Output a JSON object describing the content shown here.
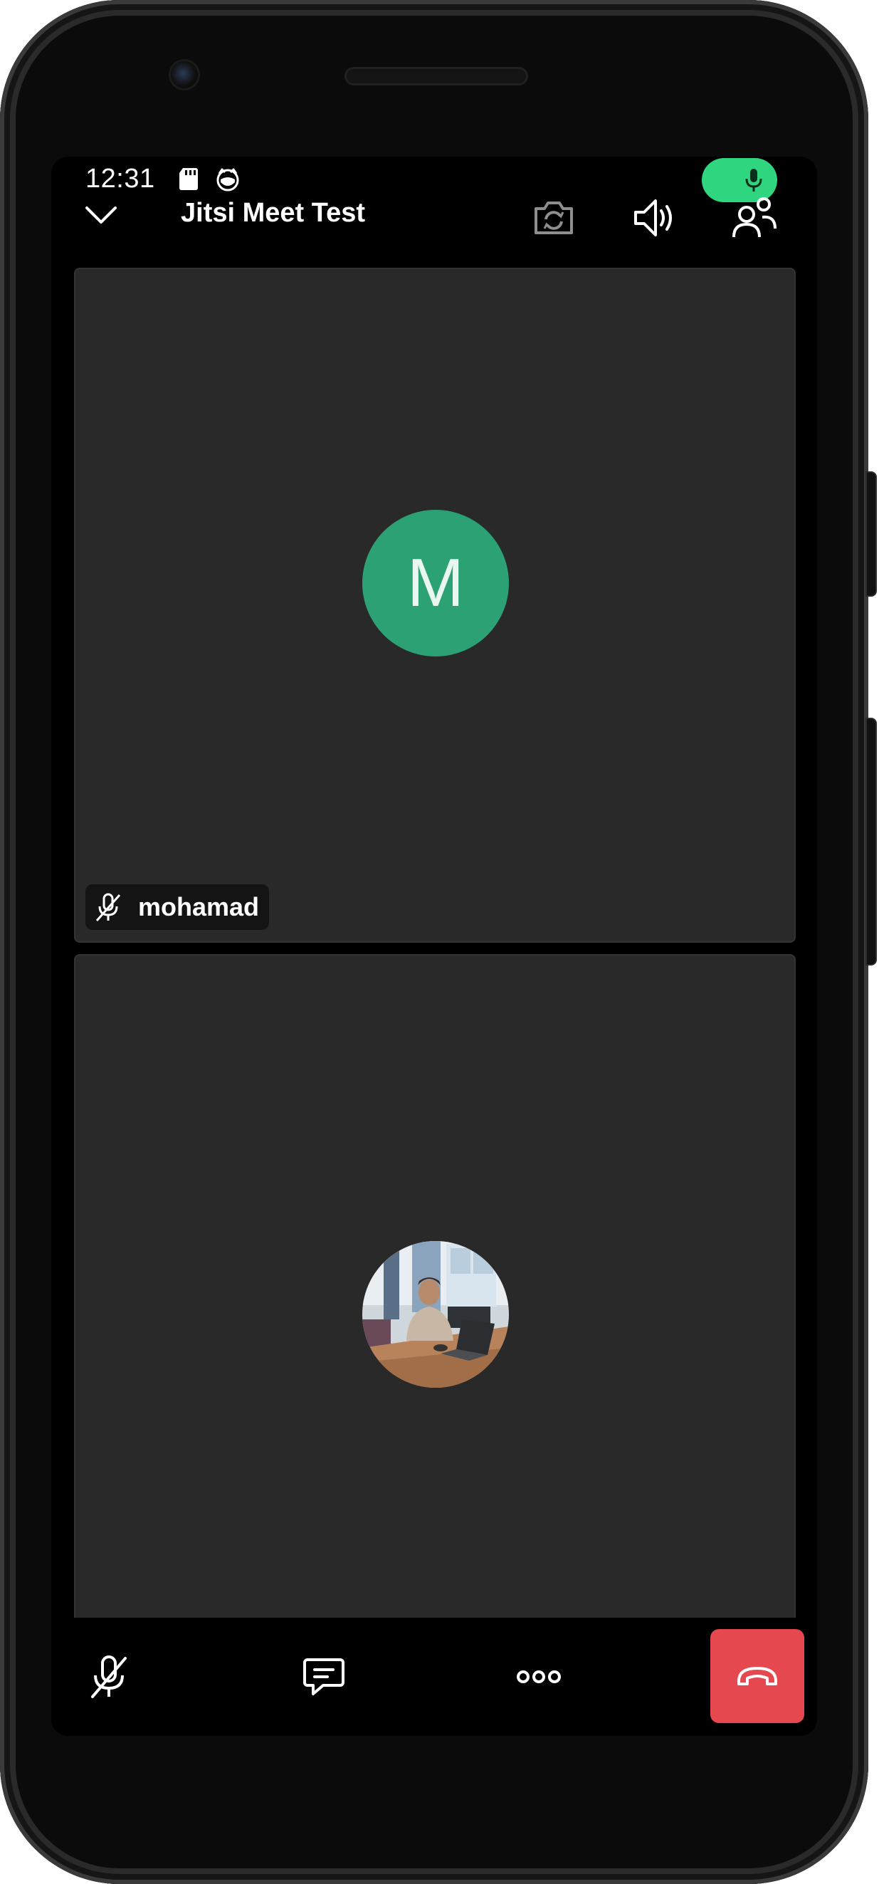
{
  "status_bar": {
    "time": "12:31",
    "icons": [
      "sd-card-icon",
      "cat-face-icon",
      "microphone-icon"
    ],
    "mic_indicator_color": "#2fd67f"
  },
  "header": {
    "back_icon": "chevron-down-icon",
    "title": "Jitsi Meet Test",
    "actions": [
      "switch-camera-icon",
      "speaker-icon",
      "participants-icon"
    ]
  },
  "tiles": [
    {
      "avatar_letter": "M",
      "avatar_color": "#2ba174",
      "name": "mohamad",
      "muted_icon": "mic-off-icon"
    },
    {
      "avatar_type": "photo"
    }
  ],
  "toolbar": {
    "buttons": [
      "mic-off-icon",
      "chat-icon",
      "more-options-icon"
    ],
    "hangup_icon": "hangup-icon",
    "hangup_color": "#e5484f"
  }
}
